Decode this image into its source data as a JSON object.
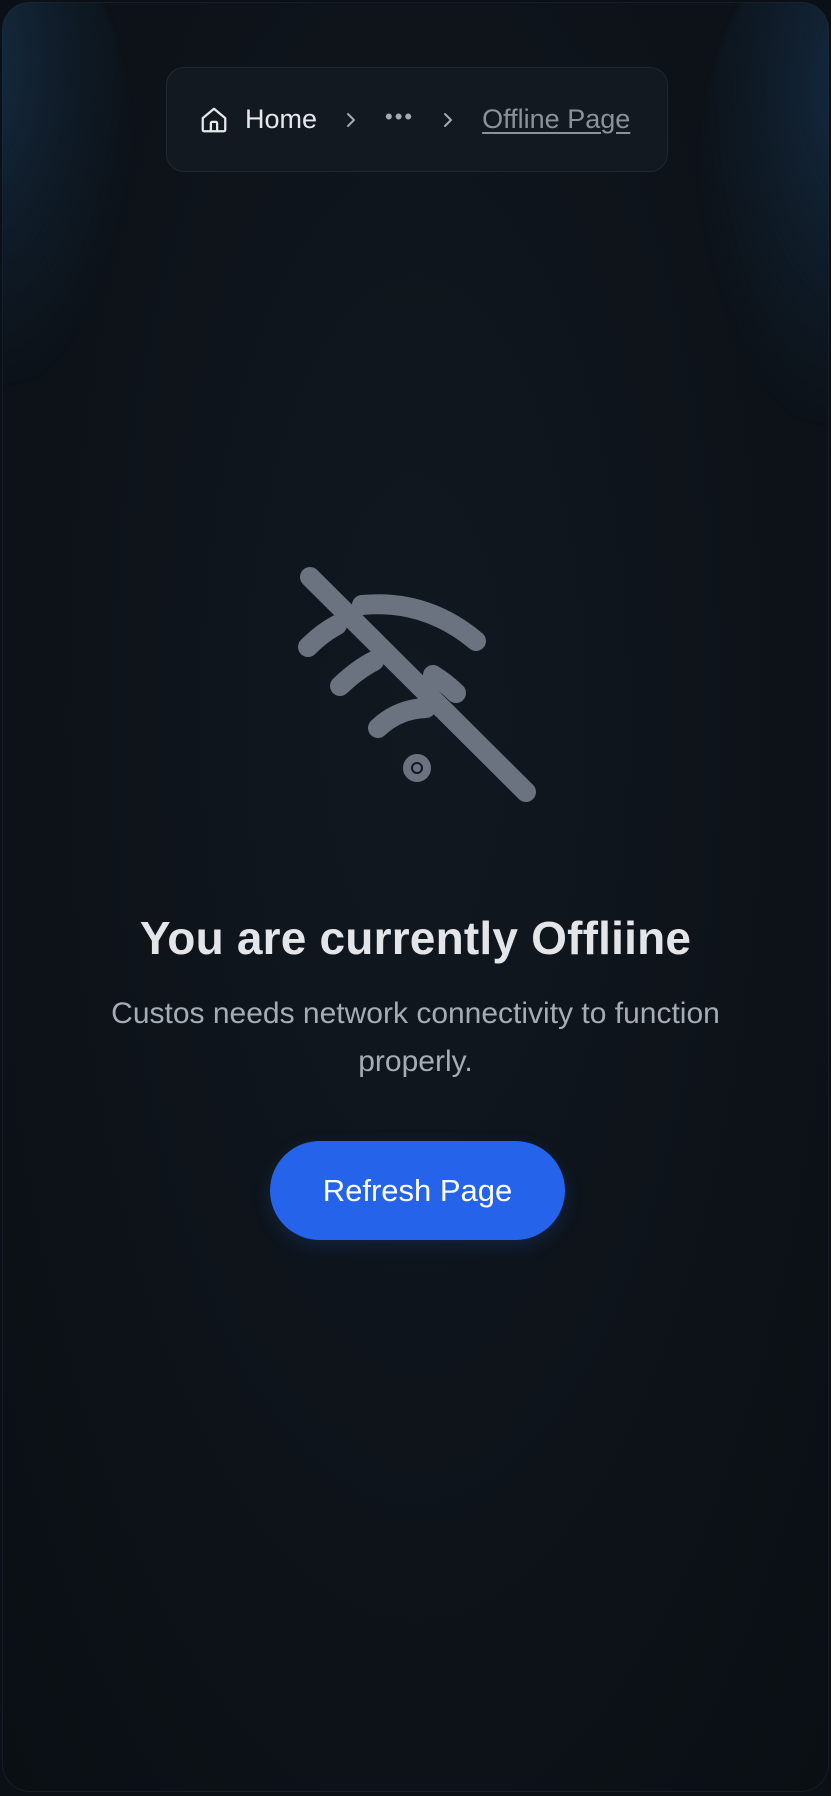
{
  "breadcrumb": {
    "home_label": "Home",
    "home_icon": "home-icon",
    "separator_icon": "chevron-right-icon",
    "ellipsis": "•••",
    "current_label": "Offline Page"
  },
  "main": {
    "icon": "wifi-off-icon",
    "title": "You are currently Offliine",
    "subtitle": "Custos needs network connectivity to function properly.",
    "refresh_label": "Refresh Page"
  },
  "colors": {
    "background": "#0d1319",
    "accent": "#2563eb",
    "icon": "#6b7280",
    "title": "#e3e5e8",
    "subtitle": "#a6acb4"
  }
}
